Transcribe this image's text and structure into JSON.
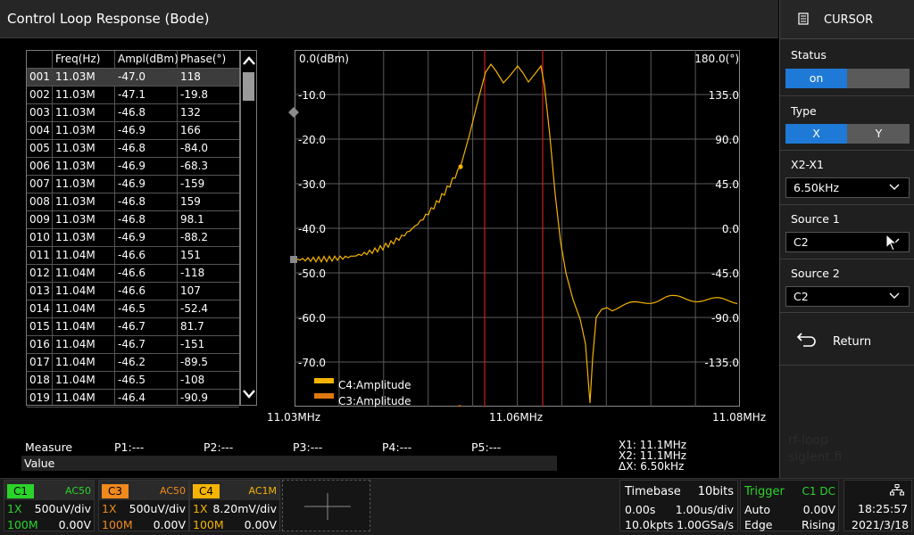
{
  "title": "Control Loop Response (Bode)",
  "table": {
    "headers": [
      "",
      "Freq(Hz)",
      "Ampl(dBm)",
      "Phase(°)"
    ],
    "rows": [
      [
        "001",
        "11.03M",
        "-47.0",
        "118"
      ],
      [
        "002",
        "11.03M",
        "-47.1",
        "-19.8"
      ],
      [
        "003",
        "11.03M",
        "-46.8",
        "132"
      ],
      [
        "004",
        "11.03M",
        "-46.9",
        "166"
      ],
      [
        "005",
        "11.03M",
        "-46.8",
        "-84.0"
      ],
      [
        "006",
        "11.03M",
        "-46.9",
        "-68.3"
      ],
      [
        "007",
        "11.03M",
        "-46.9",
        "-159"
      ],
      [
        "008",
        "11.03M",
        "-46.8",
        "159"
      ],
      [
        "009",
        "11.03M",
        "-46.8",
        "98.1"
      ],
      [
        "010",
        "11.03M",
        "-46.9",
        "-88.2"
      ],
      [
        "011",
        "11.04M",
        "-46.6",
        "151"
      ],
      [
        "012",
        "11.04M",
        "-46.6",
        "-118"
      ],
      [
        "013",
        "11.04M",
        "-46.6",
        "107"
      ],
      [
        "014",
        "11.04M",
        "-46.5",
        "-52.4"
      ],
      [
        "015",
        "11.04M",
        "-46.7",
        "81.7"
      ],
      [
        "016",
        "11.04M",
        "-46.7",
        "-151"
      ],
      [
        "017",
        "11.04M",
        "-46.2",
        "-89.5"
      ],
      [
        "018",
        "11.04M",
        "-46.5",
        "-108"
      ],
      [
        "019",
        "11.04M",
        "-46.4",
        "-90.9"
      ]
    ]
  },
  "plot": {
    "left_axis_labels": [
      "0.0(dBm)",
      "-10.0",
      "-20.0",
      "-30.0",
      "-40.0",
      "-50.0",
      "-60.0",
      "-70.0"
    ],
    "right_axis_labels": [
      "180.0(°)",
      "135.0",
      "90.0",
      "45.0",
      "0.0",
      "-45.0",
      "-90.0",
      "-135.0"
    ],
    "x_labels": [
      "11.03MHz",
      "11.06MHz",
      "11.08MHz"
    ],
    "legend": [
      {
        "name": "C4:Amplitude",
        "color": "#f5b400"
      },
      {
        "name": "C3:Amplitude",
        "color": "#e07a10"
      }
    ],
    "trace_color": "#f5b400",
    "cursor_color": "#c8201e"
  },
  "cursor_panel": {
    "header": "CURSOR",
    "status_label": "Status",
    "status_on": "on",
    "status_off": "",
    "type_label": "Type",
    "type_x": "X",
    "type_y": "Y",
    "x2x1_label": "X2-X1",
    "x2x1_value": "6.50kHz",
    "source1_label": "Source 1",
    "source1_value": "C2",
    "source2_label": "Source 2",
    "source2_value": "C2",
    "return_label": "Return"
  },
  "measure": {
    "label": "Measure",
    "p1": "P1:---",
    "p2": "P2:---",
    "p3": "P3:---",
    "p4": "P4:---",
    "p5": "P5:---",
    "value_label": "Value",
    "x1": "X1: 11.1MHz",
    "x2": "X2: 11.1MHz",
    "dx": "ΔX: 6.50kHz"
  },
  "watermark": [
    "rf-loop",
    "siglent.fi"
  ],
  "channels": [
    {
      "tag": "C1",
      "coupling": "AC50",
      "probe": "1X",
      "scale": "500uV/div",
      "bw": "100M",
      "offset": "0.00V",
      "color": "#2bd42b"
    },
    {
      "tag": "C3",
      "coupling": "AC50",
      "probe": "1X",
      "scale": "500uV/div",
      "bw": "100M",
      "offset": "0.00V",
      "color": "#f08a1c"
    },
    {
      "tag": "C4",
      "coupling": "AC1M",
      "probe": "1X",
      "scale": "8.20mV/div",
      "bw": "100M",
      "offset": "0.00V",
      "color": "#f5b400"
    }
  ],
  "timebase": {
    "label": "Timebase",
    "bits": "10bits",
    "delay": "0.00s",
    "scale": "1.00us/div",
    "points": "10.0kpts",
    "rate": "1.00GSa/s"
  },
  "trigger": {
    "label": "Trigger",
    "source": "C1 DC",
    "mode": "Auto",
    "level": "0.00V",
    "type": "Edge",
    "slope": "Rising"
  },
  "clock": {
    "time": "18:25:57",
    "date": "2021/3/18"
  }
}
